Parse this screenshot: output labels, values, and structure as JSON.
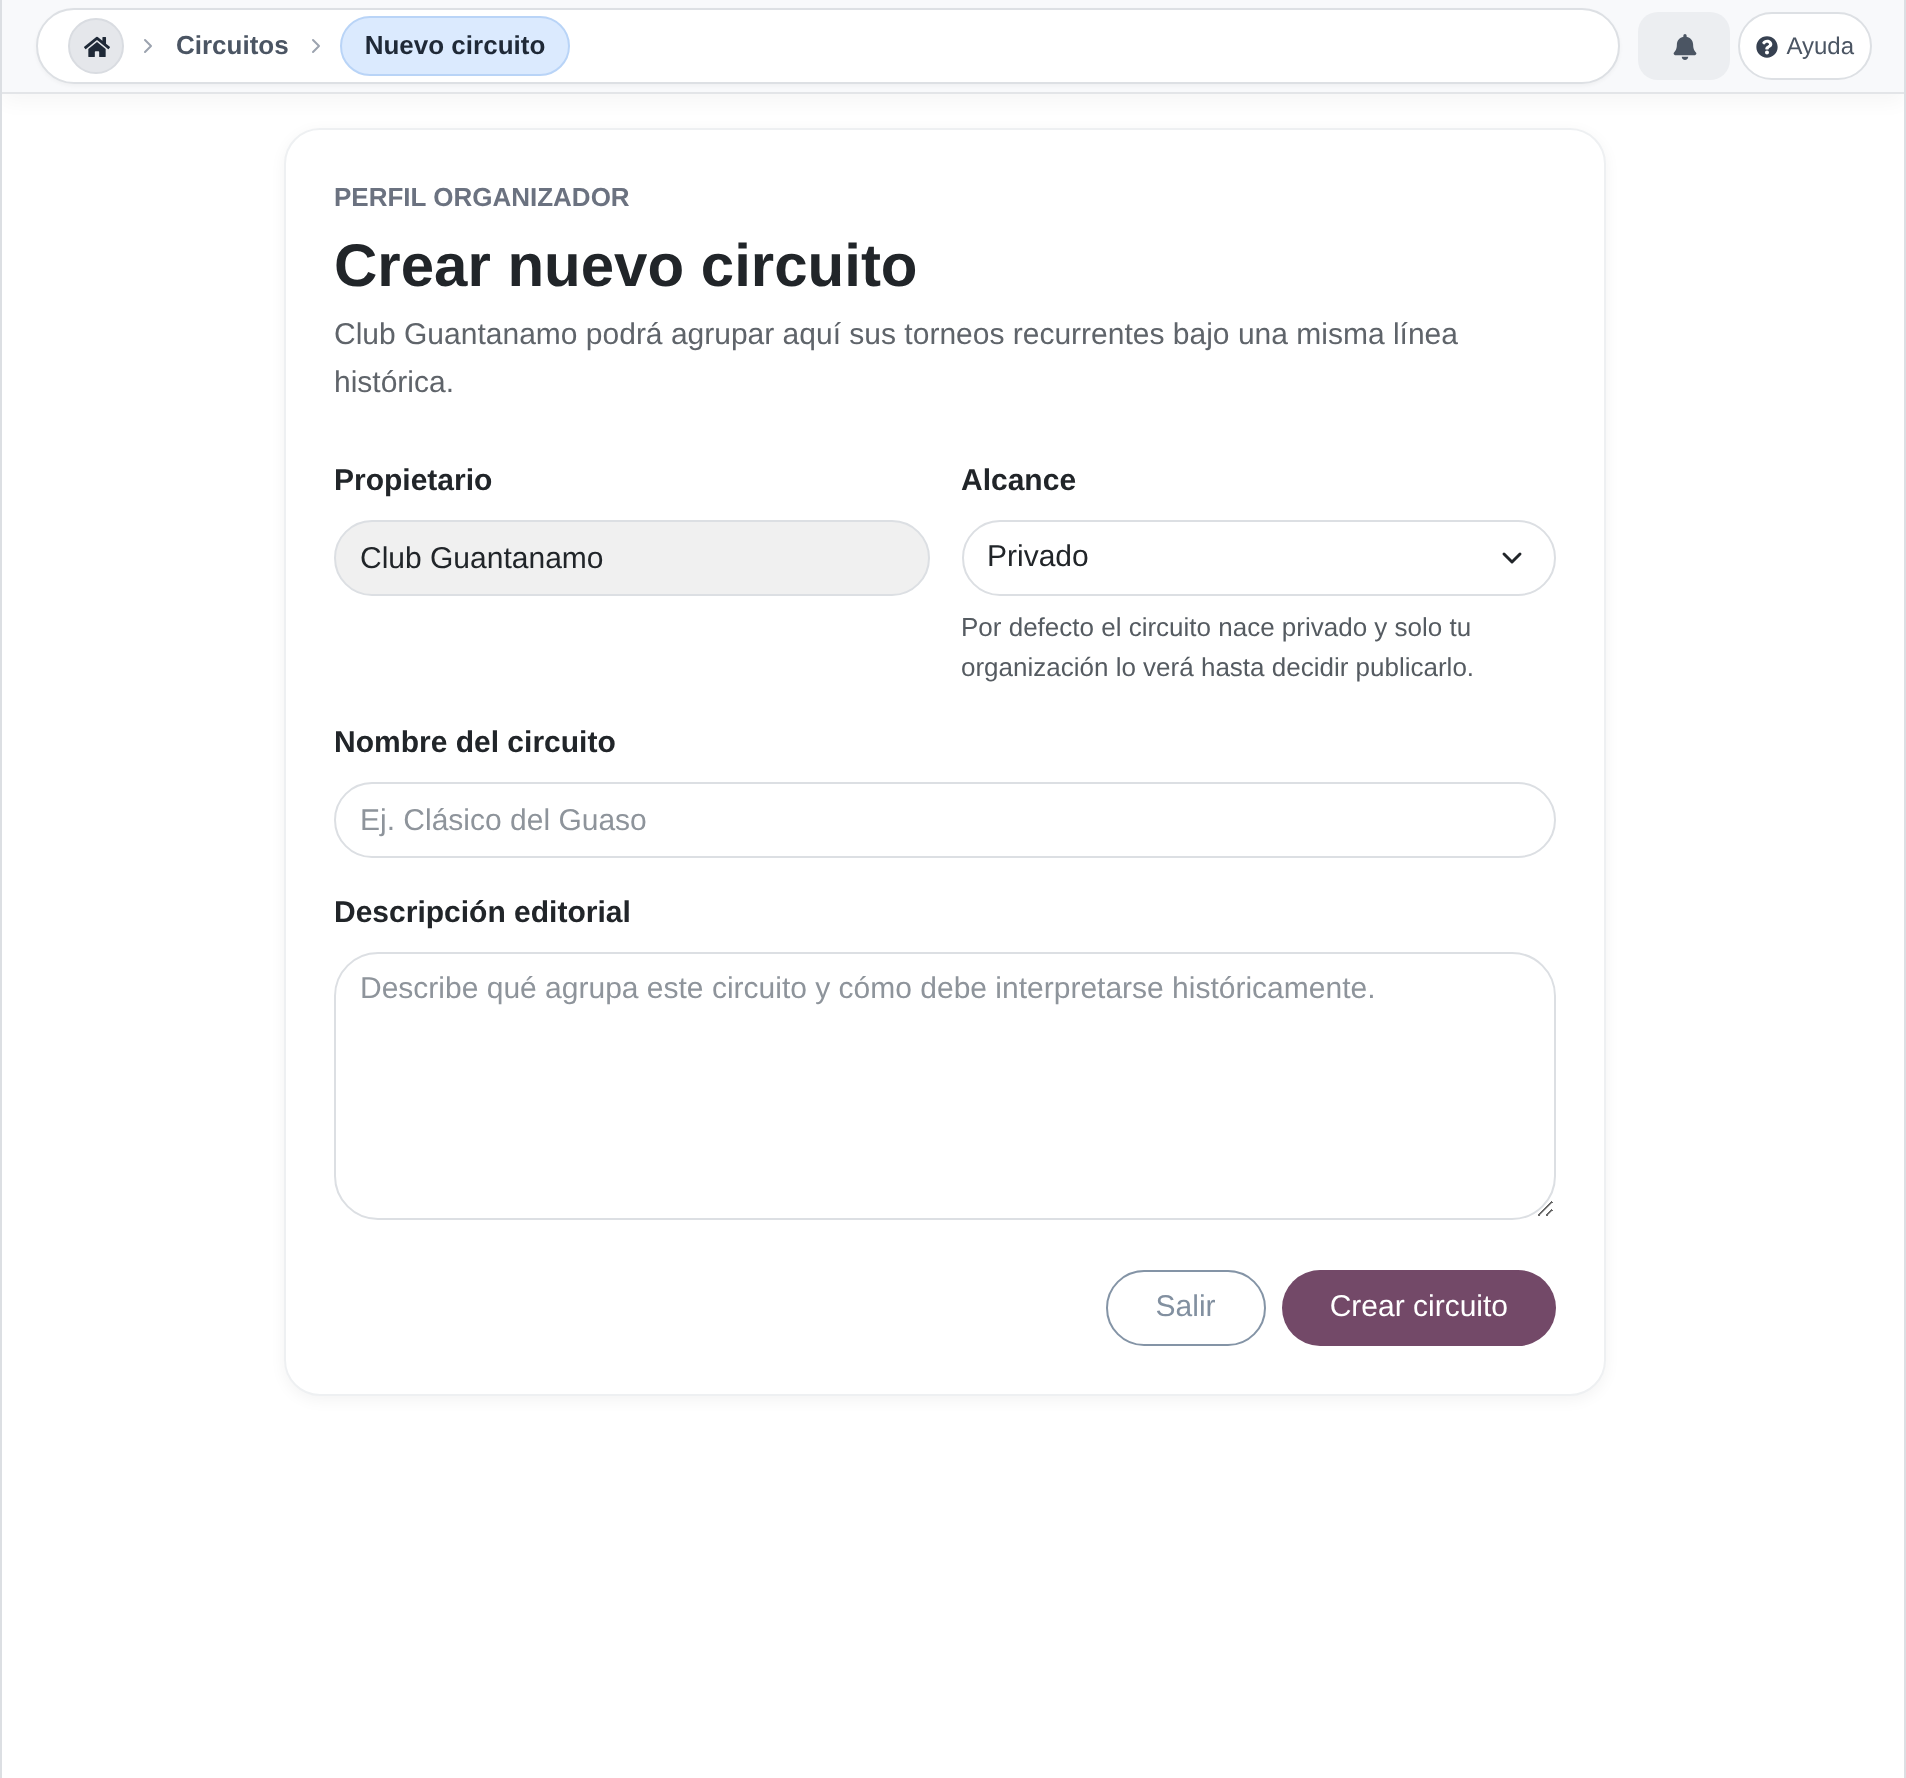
{
  "breadcrumb": {
    "items": [
      {
        "kind": "home",
        "selected": false
      },
      {
        "kind": "link",
        "label": "Circuitos",
        "selected": false
      },
      {
        "kind": "link",
        "label": "Nuevo circuito",
        "selected": true
      }
    ]
  },
  "help_button": {
    "label": "Ayuda"
  },
  "form": {
    "eyebrow": "PERFIL ORGANIZADOR",
    "title": "Crear nuevo circuito",
    "description": "Club Guantanamo podrá agrupar aquí sus torneos recurrentes bajo una misma línea histórica.",
    "rows": [
      [
        {
          "kind": "text",
          "label": "Propietario",
          "value": "Club Guantanamo",
          "disabled": true
        },
        {
          "kind": "select",
          "label": "Alcance",
          "value": "Privado",
          "hint": "Por defecto el circuito nace privado y solo tu organización lo verá hasta decidir publicarlo."
        }
      ],
      [
        {
          "kind": "text",
          "label": "Nombre del circuito",
          "placeholder": "Ej. Clásico del Guaso",
          "disabled": false
        }
      ],
      [
        {
          "kind": "textarea",
          "label": "Descripción editorial",
          "placeholder": "Describe qué agrupa este circuito y cómo debe interpretarse históricamente."
        }
      ]
    ],
    "buttons": [
      {
        "kind": "secondary",
        "label": "Salir"
      },
      {
        "kind": "primary",
        "label": "Crear circuito"
      }
    ]
  }
}
